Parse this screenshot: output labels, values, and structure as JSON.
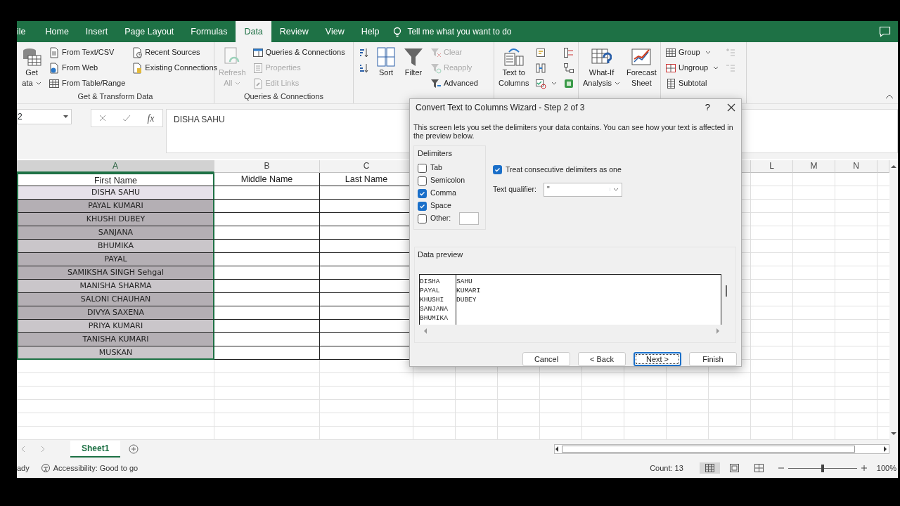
{
  "ribbon_tabs": [
    {
      "label": "ile",
      "selected": false
    },
    {
      "label": "Home",
      "selected": false
    },
    {
      "label": "Insert",
      "selected": false
    },
    {
      "label": "Page Layout",
      "selected": false
    },
    {
      "label": "Formulas",
      "selected": false
    },
    {
      "label": "Data",
      "selected": true
    },
    {
      "label": "Review",
      "selected": false
    },
    {
      "label": "View",
      "selected": false
    },
    {
      "label": "Help",
      "selected": false
    }
  ],
  "tell_me": "Tell me what you want to do",
  "ribbon_groups": [
    {
      "label": "Get & Transform Data",
      "items": [
        {
          "kind": "large",
          "lines": [
            "Get",
            "ata"
          ],
          "dropdown": true,
          "disabled": false
        },
        {
          "kind": "column",
          "buttons": [
            {
              "label": "From Text/CSV",
              "disabled": false
            },
            {
              "label": "From Web",
              "disabled": false
            },
            {
              "label": "From Table/Range",
              "disabled": false
            }
          ]
        },
        {
          "kind": "column",
          "buttons": [
            {
              "label": "Recent Sources",
              "disabled": false
            },
            {
              "label": "Existing Connections",
              "disabled": false
            }
          ]
        }
      ]
    },
    {
      "label": "Queries & Connections",
      "items": [
        {
          "kind": "large",
          "lines": [
            "Refresh",
            "All"
          ],
          "dropdown": true,
          "disabled": true
        },
        {
          "kind": "column",
          "buttons": [
            {
              "label": "Queries & Connections",
              "disabled": false
            },
            {
              "label": "Properties",
              "disabled": true
            },
            {
              "label": "Edit Links",
              "disabled": true
            }
          ]
        }
      ]
    },
    {
      "items": [
        {
          "kind": "column",
          "buttons": [
            {
              "disabled": false
            },
            {
              "disabled": false
            }
          ]
        },
        {
          "kind": "large",
          "lines": [
            "Sort"
          ],
          "dropdown": false,
          "disabled": false
        },
        {
          "kind": "large",
          "lines": [
            "Filter"
          ],
          "dropdown": false,
          "disabled": false
        },
        {
          "kind": "column",
          "buttons": [
            {
              "label": "Clear",
              "disabled": true
            },
            {
              "label": "Reapply",
              "disabled": true
            },
            {
              "label": "Advanced",
              "disabled": false
            }
          ]
        }
      ]
    },
    {
      "items": [
        {
          "kind": "large",
          "lines": [
            "Text to",
            "Columns"
          ],
          "dropdown": false,
          "disabled": false
        },
        {
          "kind": "column",
          "buttons": [
            {
              "disabled": false
            },
            {
              "disabled": false
            },
            {
              "disabled": false,
              "dropdown": true
            }
          ]
        },
        {
          "kind": "column",
          "buttons": [
            {
              "disabled": false
            },
            {
              "disabled": false
            },
            {
              "disabled": false
            }
          ]
        }
      ]
    },
    {
      "items": [
        {
          "kind": "large",
          "lines": [
            "What-If",
            "Analysis"
          ],
          "dropdown": true,
          "disabled": false
        },
        {
          "kind": "large",
          "lines": [
            "Forecast",
            "Sheet"
          ],
          "dropdown": false,
          "disabled": false
        }
      ]
    },
    {
      "items": [
        {
          "kind": "column",
          "buttons": [
            {
              "label": "Group",
              "disabled": false,
              "dropdown": true
            },
            {
              "label": "Ungroup",
              "disabled": false,
              "dropdown": true
            },
            {
              "label": "Subtotal",
              "disabled": false
            }
          ]
        },
        {
          "kind": "column",
          "buttons": [
            {
              "disabled": true
            },
            {
              "disabled": true
            }
          ]
        }
      ]
    }
  ],
  "formula_bar": {
    "name_box": "2",
    "function_label": "fx",
    "formula": "DISHA SAHU"
  },
  "sheet": {
    "columns": [
      {
        "letter": "A",
        "selected": true
      },
      {
        "letter": "B",
        "selected": false
      },
      {
        "letter": "C",
        "selected": false
      },
      {
        "letter": "L",
        "selected": false
      },
      {
        "letter": "M",
        "selected": false
      },
      {
        "letter": "N",
        "selected": false
      }
    ],
    "rows": [
      {
        "cells": [
          "First Name",
          "Middle Name",
          "Last Name"
        ],
        "kind": "header"
      },
      {
        "cells": [
          "DISHA SAHU",
          "",
          ""
        ],
        "kind": "data",
        "color": "#e6e1ea"
      },
      {
        "cells": [
          "PAYAL KUMARI",
          "",
          ""
        ],
        "kind": "data",
        "color": "#b4afb4"
      },
      {
        "cells": [
          "KHUSHI DUBEY",
          "",
          ""
        ],
        "kind": "data",
        "color": "#b4afb4"
      },
      {
        "cells": [
          "SANJANA",
          "",
          ""
        ],
        "kind": "data",
        "color": "#b4afb4"
      },
      {
        "cells": [
          "BHUMIKA",
          "",
          ""
        ],
        "kind": "data",
        "color": "#cac6ca"
      },
      {
        "cells": [
          "PAYAL",
          "",
          ""
        ],
        "kind": "data",
        "color": "#b4afb4"
      },
      {
        "cells": [
          "SAMIKSHA SINGH Sehgal",
          "",
          ""
        ],
        "kind": "data",
        "color": "#b4afb4"
      },
      {
        "cells": [
          "MANISHA SHARMA",
          "",
          ""
        ],
        "kind": "data",
        "color": "#cac6ca"
      },
      {
        "cells": [
          "SALONI CHAUHAN",
          "",
          ""
        ],
        "kind": "data",
        "color": "#b4afb4"
      },
      {
        "cells": [
          "DIVYA SAXENA",
          "",
          ""
        ],
        "kind": "data",
        "color": "#b4afb4"
      },
      {
        "cells": [
          "PRIYA KUMARI",
          "",
          ""
        ],
        "kind": "data",
        "color": "#cac6ca"
      },
      {
        "cells": [
          "TANISHA KUMARI",
          "",
          ""
        ],
        "kind": "data",
        "color": "#b4afb4"
      },
      {
        "cells": [
          "MUSKAN",
          "",
          ""
        ],
        "kind": "data",
        "color": "#cac6ca"
      }
    ]
  },
  "dialog": {
    "title": "Convert Text to Columns Wizard - Step 2 of 3",
    "help": "?",
    "description": "This screen lets you set the delimiters your data contains.  You can see how your text is affected in the preview below.",
    "delimiters_label": "Delimiters",
    "delimiters": [
      {
        "label": "Tab",
        "checked": false
      },
      {
        "label": "Semicolon",
        "checked": false
      },
      {
        "label": "Comma",
        "checked": true
      },
      {
        "label": "Space",
        "checked": true
      },
      {
        "label": "Other:",
        "checked": false,
        "kind": "other"
      }
    ],
    "consecutive": {
      "label": "Treat consecutive delimiters as one",
      "checked": true
    },
    "qualifier": {
      "label": "Text qualifier:",
      "value": "\""
    },
    "preview_label": "Data preview",
    "preview_rows": [
      [
        "DISHA",
        "SAHU"
      ],
      [
        "PAYAL",
        "KUMARI"
      ],
      [
        "KHUSHI",
        "DUBEY"
      ],
      [
        "SANJANA",
        ""
      ],
      [
        "BHUMIKA",
        ""
      ]
    ],
    "buttons": [
      {
        "label": "Cancel",
        "default": false
      },
      {
        "label": "< Back",
        "default": false
      },
      {
        "label": "Next >",
        "default": true
      },
      {
        "label": "Finish",
        "default": false
      }
    ]
  },
  "sheet_tabs": [
    {
      "label": "Sheet1",
      "selected": true
    }
  ],
  "status_bar": {
    "ready": "ady",
    "accessibility": "Accessibility: Good to go",
    "count": "Count: 13",
    "views": [
      {
        "selected": true
      },
      {
        "selected": false
      },
      {
        "selected": false
      }
    ],
    "zoom": {
      "level": 0.5,
      "reading": "100%"
    }
  }
}
